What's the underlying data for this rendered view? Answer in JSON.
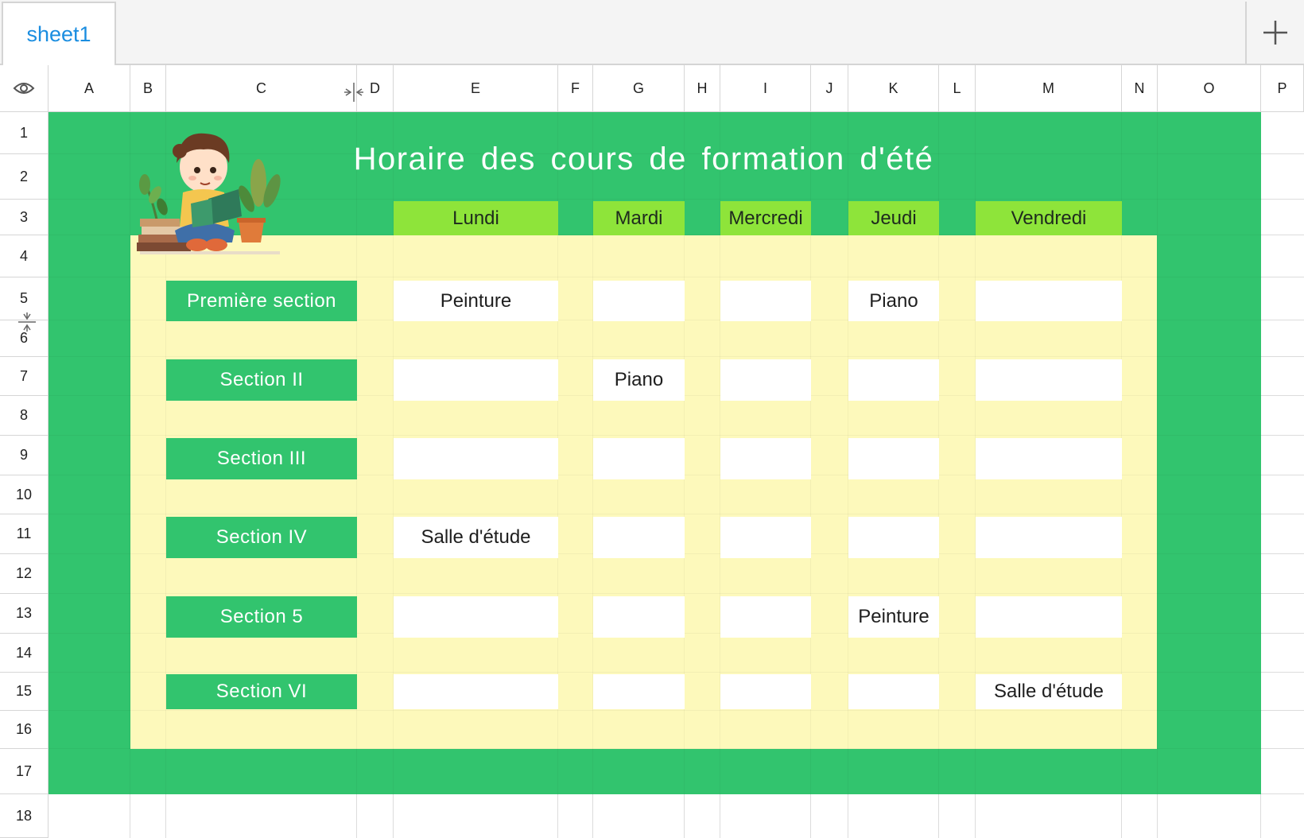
{
  "tabs": {
    "active": "sheet1"
  },
  "columns": [
    "A",
    "B",
    "C",
    "D",
    "E",
    "F",
    "G",
    "H",
    "I",
    "J",
    "K",
    "L",
    "M",
    "N",
    "O",
    "P"
  ],
  "rows": [
    "1",
    "2",
    "3",
    "4",
    "5",
    "6",
    "7",
    "8",
    "9",
    "10",
    "11",
    "12",
    "13",
    "14",
    "15",
    "16",
    "17",
    "18"
  ],
  "title": "Horaire des cours de formation d'été",
  "days": [
    "Lundi",
    "Mardi",
    "Mercredi",
    "Jeudi",
    "Vendredi"
  ],
  "sections": [
    {
      "label": "Première section",
      "cells": [
        "Peinture",
        "",
        "",
        "Piano",
        ""
      ]
    },
    {
      "label": "Section II",
      "cells": [
        "",
        "Piano",
        "",
        "",
        ""
      ]
    },
    {
      "label": "Section III",
      "cells": [
        "",
        "",
        "",
        "",
        ""
      ]
    },
    {
      "label": "Section IV",
      "cells": [
        "Salle d'étude",
        "",
        "",
        "",
        ""
      ]
    },
    {
      "label": "Section 5",
      "cells": [
        "",
        "",
        "",
        "Peinture",
        ""
      ]
    },
    {
      "label": "Section VI",
      "cells": [
        "",
        "",
        "",
        "",
        "Salle d'étude"
      ]
    }
  ],
  "icons": {
    "visibility": "eye-icon",
    "add_sheet": "plus-icon",
    "col_resize": "column-resize-icon",
    "row_resize": "row-resize-icon",
    "illustration": "child-reading-illustration"
  },
  "colors": {
    "frame_green": "#32c46e",
    "day_header_green": "#8ee43a",
    "body_yellow": "#fdf9bb",
    "tab_blue": "#1a8de0"
  }
}
